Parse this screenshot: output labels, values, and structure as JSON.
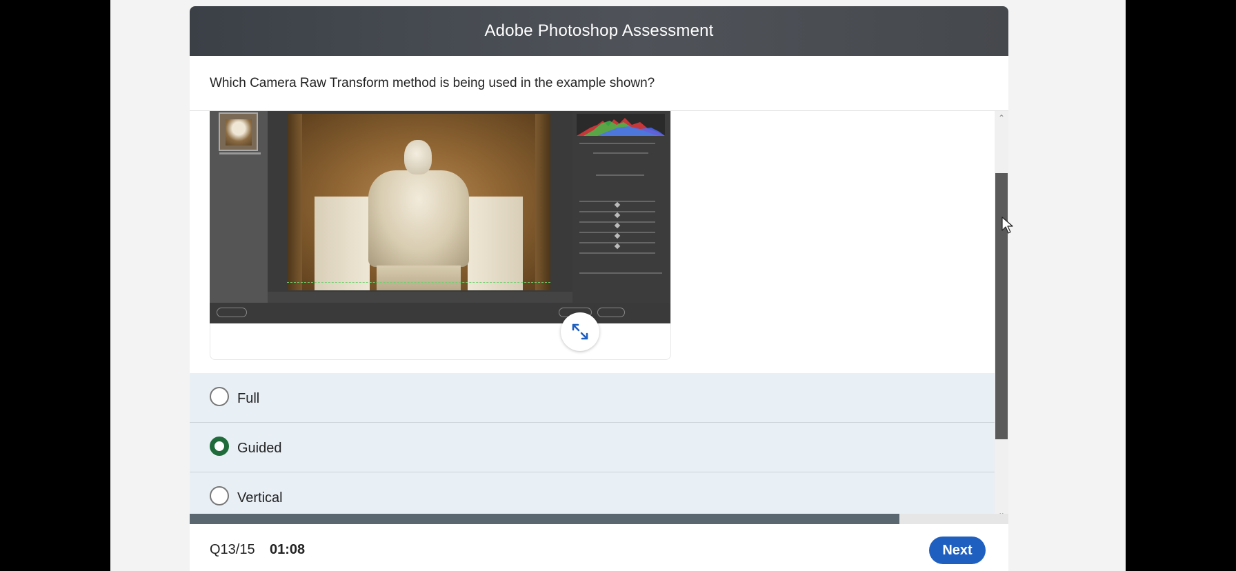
{
  "header": {
    "title": "Adobe Photoshop Assessment"
  },
  "question": {
    "text": "Which Camera Raw Transform method is being used in the example shown?"
  },
  "media": {
    "expand_icon": "expand-arrows-icon"
  },
  "options": [
    {
      "label": "Full",
      "selected": false
    },
    {
      "label": "Guided",
      "selected": true
    },
    {
      "label": "Vertical",
      "selected": false
    }
  ],
  "progress": {
    "fraction": 0.867
  },
  "footer": {
    "counter": "Q13/15",
    "timer": "01:08",
    "next_label": "Next"
  },
  "colors": {
    "selected_radio": "#1f6b3a",
    "next_button": "#1f5fbf",
    "header_bg": "#3b4047",
    "options_bg": "#e8eff5"
  }
}
